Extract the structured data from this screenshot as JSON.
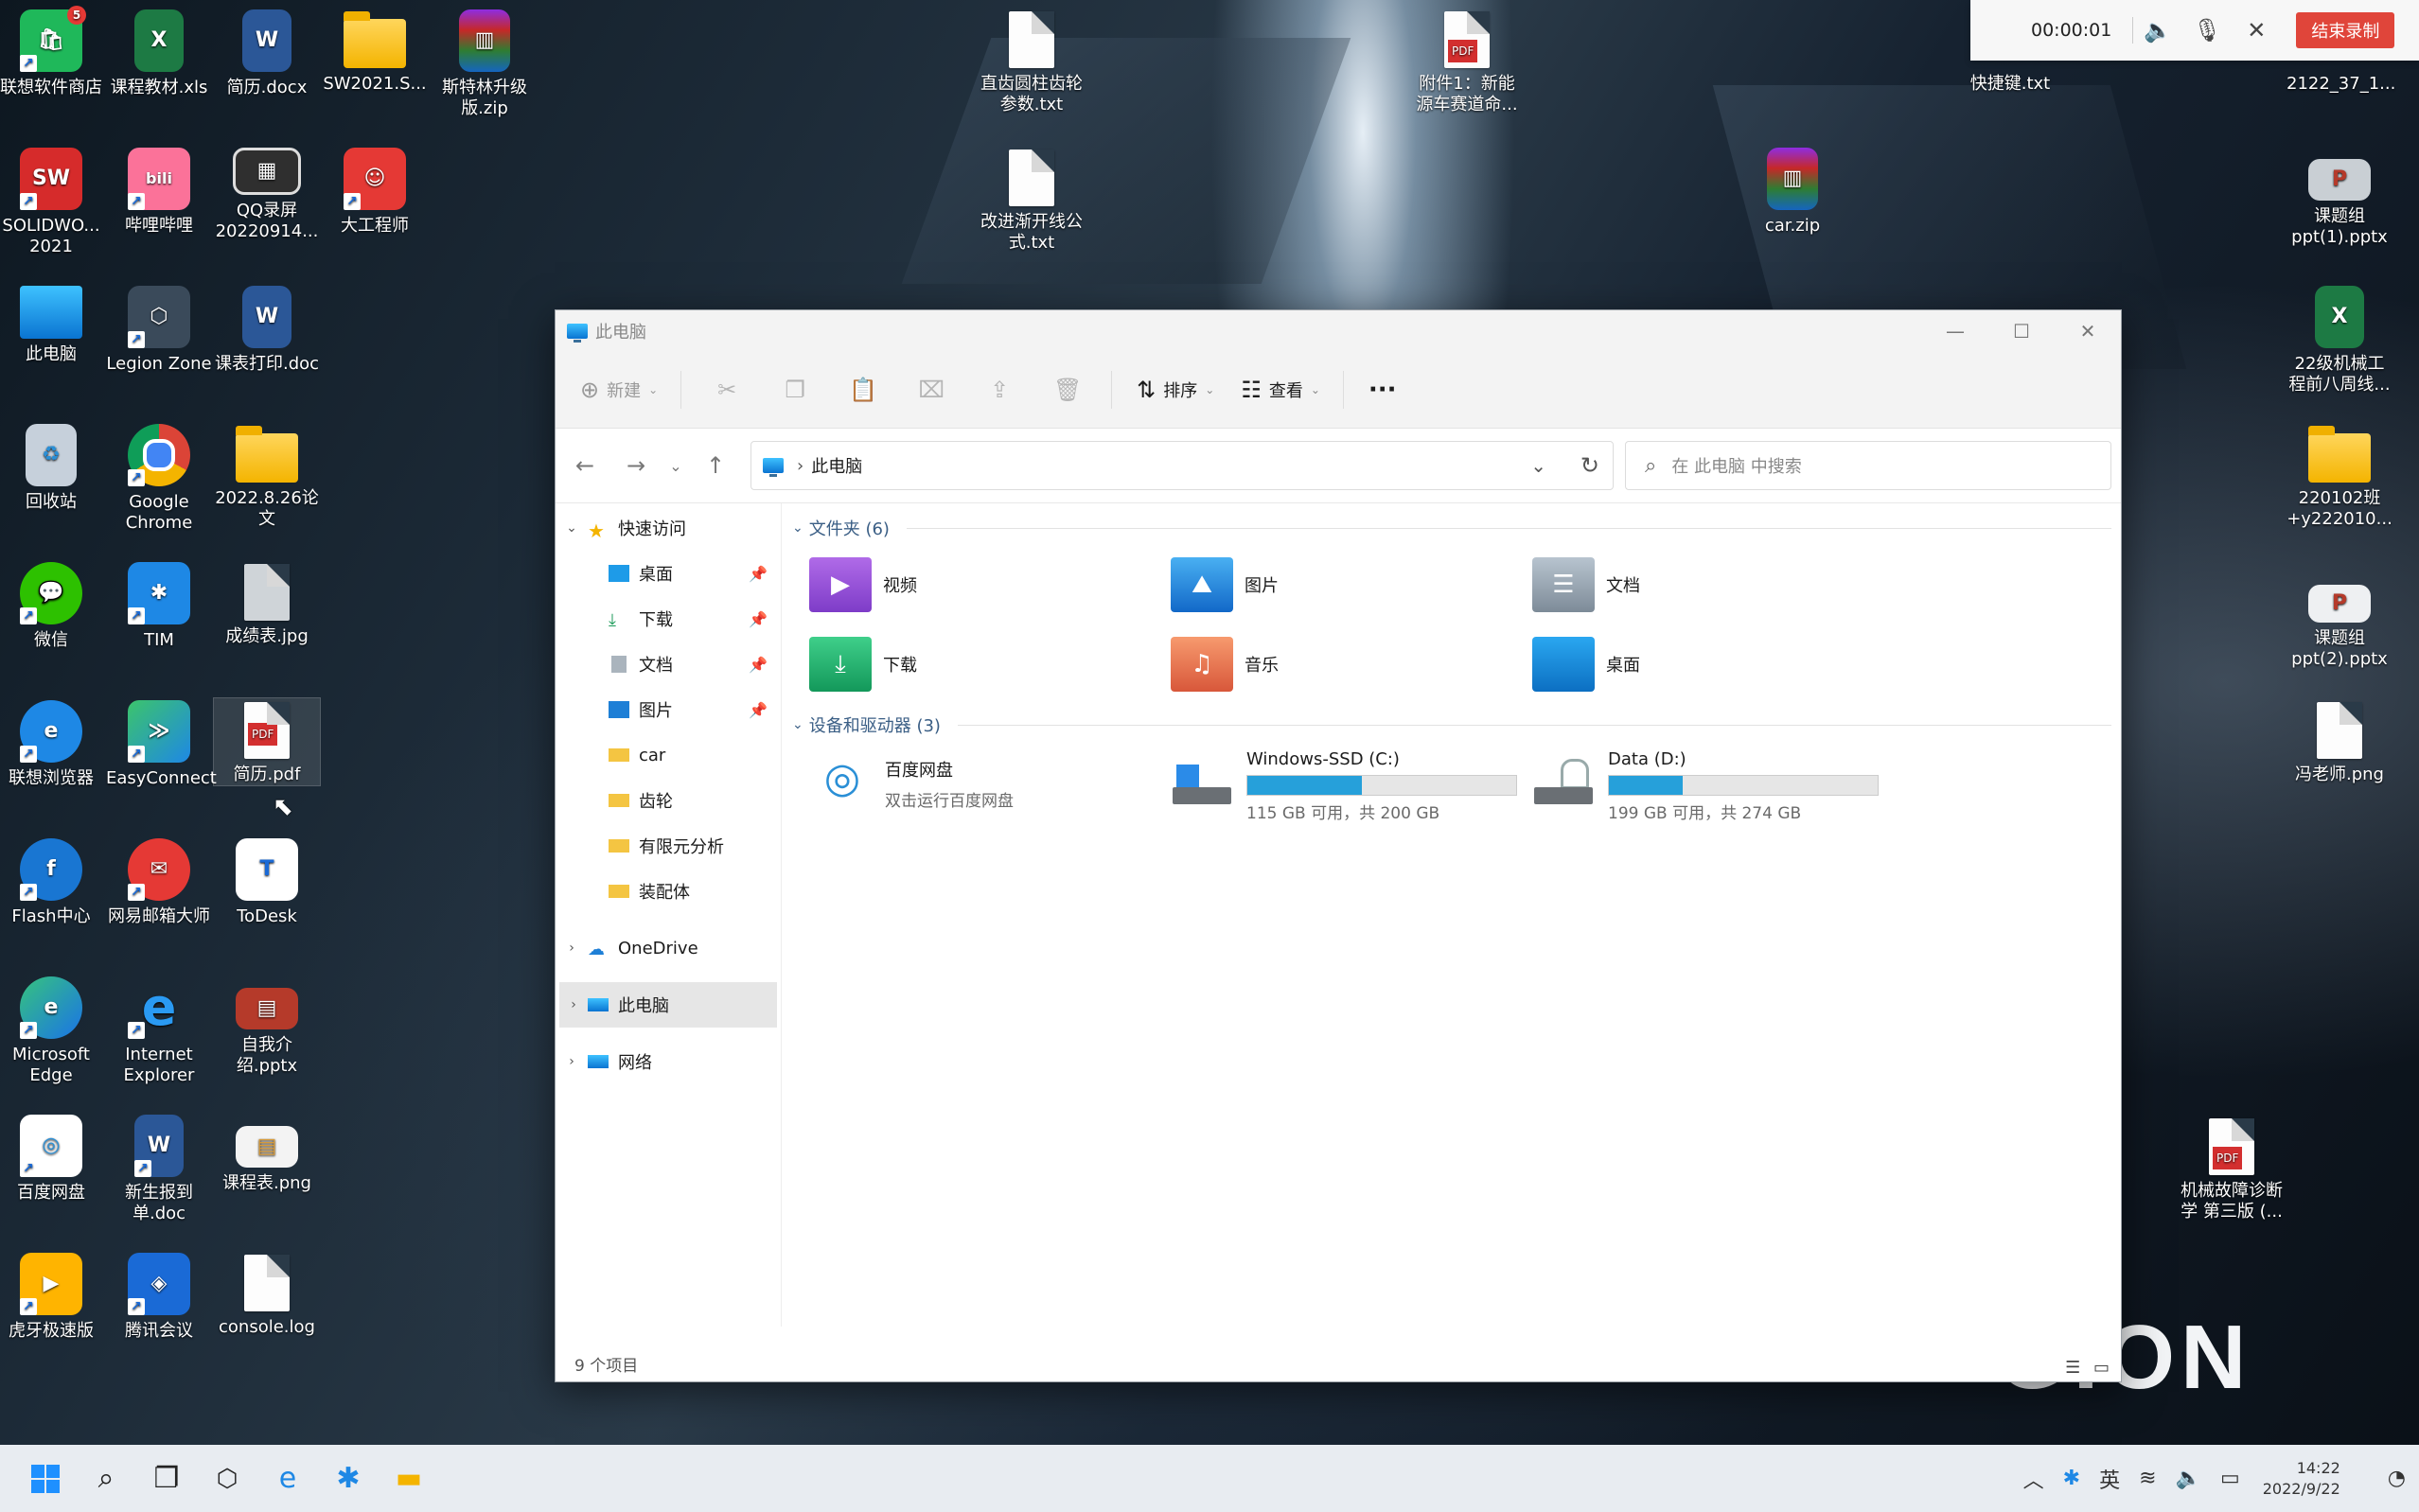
{
  "desktop": {
    "icons": [
      {
        "label": "联想软件商店",
        "badge": "5"
      },
      {
        "label": "课程教材.xls"
      },
      {
        "label": "简历.docx"
      },
      {
        "label": "SW2021.S..."
      },
      {
        "label": "斯特林升级版.zip"
      },
      {
        "label": "SOLIDWO... 2021"
      },
      {
        "label": "哔哩哔哩"
      },
      {
        "label": "QQ录屏 20220914..."
      },
      {
        "label": "大工程师"
      },
      {
        "label": "此电脑"
      },
      {
        "label": "Legion Zone"
      },
      {
        "label": "课表打印.doc"
      },
      {
        "label": "回收站"
      },
      {
        "label": "Google Chrome"
      },
      {
        "label": "2022.8.26论文"
      },
      {
        "label": "微信"
      },
      {
        "label": "TIM"
      },
      {
        "label": "成绩表.jpg"
      },
      {
        "label": "联想浏览器"
      },
      {
        "label": "EasyConnect"
      },
      {
        "label": "简历.pdf"
      },
      {
        "label": "Flash中心"
      },
      {
        "label": "网易邮箱大师"
      },
      {
        "label": "ToDesk"
      },
      {
        "label": "Microsoft Edge"
      },
      {
        "label": "Internet Explorer"
      },
      {
        "label": "自我介绍.pptx"
      },
      {
        "label": "百度网盘"
      },
      {
        "label": "新生报到单.doc"
      },
      {
        "label": "课程表.png"
      },
      {
        "label": "虎牙极速版"
      },
      {
        "label": "腾讯会议"
      },
      {
        "label": "console.log"
      },
      {
        "label": "直齿圆柱齿轮参数.txt"
      },
      {
        "label": "改进渐开线公式.txt"
      },
      {
        "label": "附件1：新能源车赛道命..."
      },
      {
        "label": "car.zip"
      },
      {
        "label": "快捷键.txt"
      },
      {
        "label": "2122_37_1..."
      },
      {
        "label": "课题组 ppt(1).pptx"
      },
      {
        "label": "22级机械工程前八周线..."
      },
      {
        "label": "220102班 +y222010..."
      },
      {
        "label": "课题组 ppt(2).pptx"
      },
      {
        "label": "冯老师.png"
      },
      {
        "label": "机械故障诊断学 第三版 (..."
      }
    ],
    "pdf_tag": "PDF",
    "brand_text": "GION"
  },
  "recorder": {
    "time": "00:00:01",
    "stop_label": "结束录制"
  },
  "explorer": {
    "title": "此电脑",
    "toolbar": {
      "new": "新建",
      "sort": "排序",
      "view": "查看",
      "more": "···"
    },
    "address": "此电脑",
    "search_placeholder": "在 此电脑 中搜索",
    "nav": {
      "quick_access": "快速访问",
      "quick_items": [
        "桌面",
        "下载",
        "文档",
        "图片",
        "car",
        "齿轮",
        "有限元分析",
        "装配体"
      ],
      "onedrive": "OneDrive",
      "this_pc": "此电脑",
      "network": "网络"
    },
    "folders_header": "文件夹 (6)",
    "folders": [
      "视频",
      "图片",
      "文档",
      "下载",
      "音乐",
      "桌面"
    ],
    "drives_header": "设备和驱动器 (3)",
    "drives": [
      {
        "name": "百度网盘",
        "sub": "双击运行百度网盘"
      },
      {
        "name": "Windows-SSD (C:)",
        "sub": "115 GB 可用，共 200 GB",
        "used_fraction": 0.425
      },
      {
        "name": "Data (D:)",
        "sub": "199 GB 可用，共 274 GB",
        "used_fraction": 0.274
      }
    ],
    "status": "9 个项目"
  },
  "taskbar": {
    "ime": "英",
    "time": "14:22",
    "date": "2022/9/22"
  }
}
